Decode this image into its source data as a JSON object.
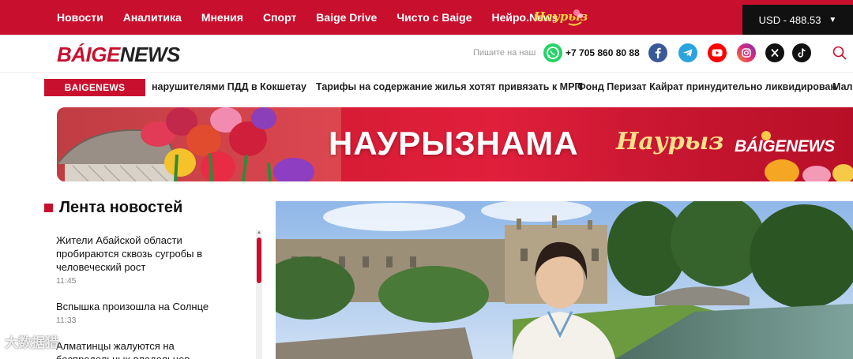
{
  "nav": {
    "items": [
      "Новости",
      "Аналитика",
      "Мнения",
      "Спорт",
      "Baige Drive",
      "Чисто с Baige",
      "Нейро.News"
    ],
    "nauryz_logo": "Наурыз",
    "currency": "USD - 488.53"
  },
  "header": {
    "logo_part1": "BÁIGE",
    "logo_part2": "NEWS",
    "write_us": "Пишите на наш",
    "phone": "+7 705 860 80 88",
    "social_icons": [
      "facebook-icon",
      "telegram-icon",
      "youtube-icon",
      "instagram-icon",
      "x-icon",
      "tiktok-icon"
    ]
  },
  "ticker": {
    "label": "BAIGENEWS",
    "items": [
      "нарушителями ПДД в Кокшетау",
      "Тарифы на содержание жилья хотят привязать к МРП",
      "Фонд Перизат Кайрат принудительно ликвидирован",
      "Мал"
    ]
  },
  "banner": {
    "title": "НАУРЫЗНАМА",
    "nauryz": "Наурыз",
    "logo": "BÁIGENEWS"
  },
  "feed": {
    "title": "Лента новостей",
    "items": [
      {
        "title": "Жители Абайской области пробираются сквозь сугробы в человеческий рост",
        "time": "11:45"
      },
      {
        "title": "Вспышка произошла на Солнце",
        "time": "11:33"
      },
      {
        "title": "Алматинцы жалуются на беспредельных владельцев",
        "time": ""
      }
    ]
  },
  "watermark": "大数据猎",
  "colors": {
    "brand_red": "#c8102e",
    "whatsapp": "#25d366",
    "facebook": "#3b5998",
    "telegram": "#2aa3df",
    "youtube": "#ff0000",
    "currency_bg": "#111111"
  }
}
